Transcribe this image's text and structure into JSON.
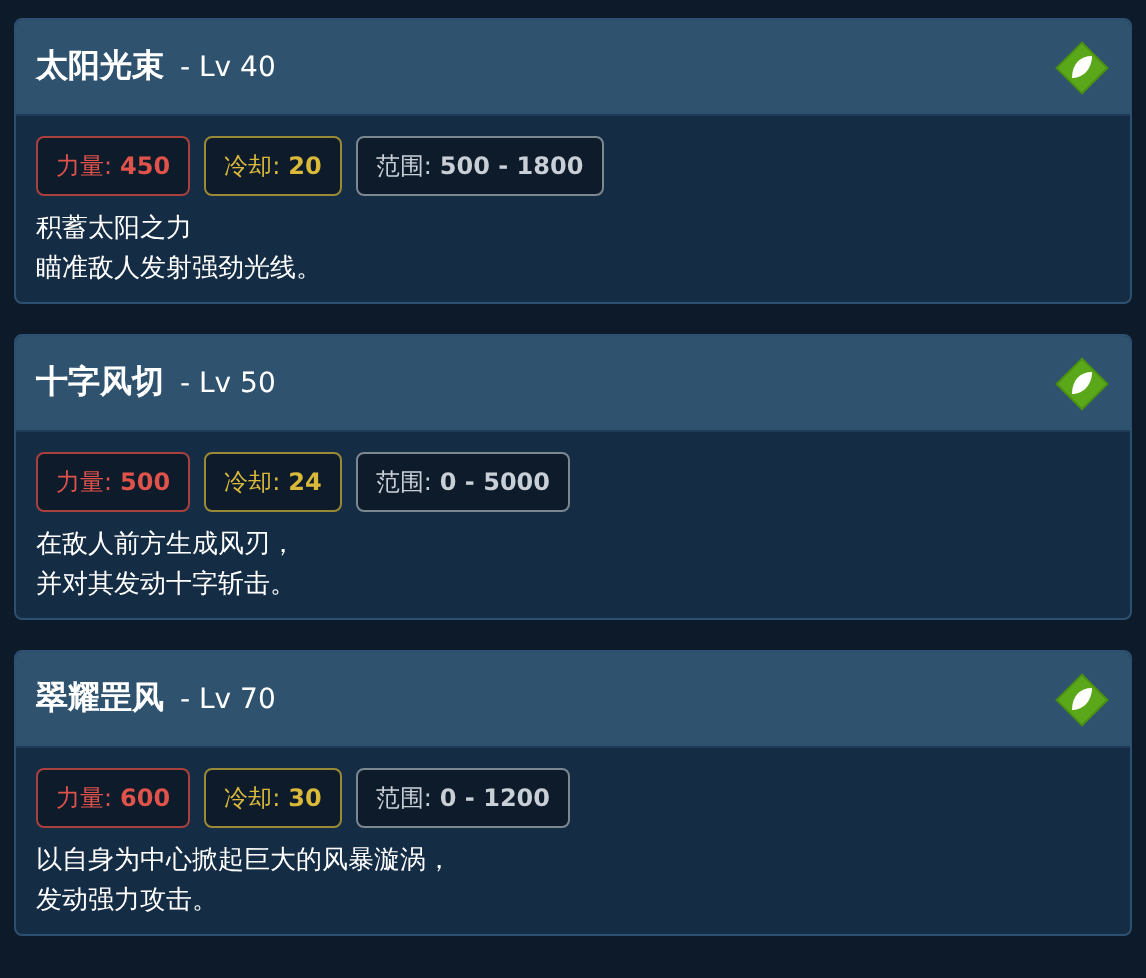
{
  "skills": [
    {
      "name": "太阳光束",
      "level": "- Lv 40",
      "stats": [
        {
          "kind": "power",
          "label": "力量:",
          "value": "450"
        },
        {
          "kind": "cooldown",
          "label": "冷却:",
          "value": "20"
        },
        {
          "kind": "range",
          "label": "范围:",
          "value": "500 - 1800"
        }
      ],
      "description": [
        "积蓄太阳之力",
        "瞄准敌人发射强劲光线。"
      ]
    },
    {
      "name": "十字风切",
      "level": "- Lv 50",
      "stats": [
        {
          "kind": "power",
          "label": "力量:",
          "value": "500"
        },
        {
          "kind": "cooldown",
          "label": "冷却:",
          "value": "24"
        },
        {
          "kind": "range",
          "label": "范围:",
          "value": "0 - 5000"
        }
      ],
      "description": [
        "在敌人前方生成风刃，",
        "并对其发动十字斩击。"
      ]
    },
    {
      "name": "翠耀罡风",
      "level": "- Lv 70",
      "stats": [
        {
          "kind": "power",
          "label": "力量:",
          "value": "600"
        },
        {
          "kind": "cooldown",
          "label": "冷却:",
          "value": "30"
        },
        {
          "kind": "range",
          "label": "范围:",
          "value": "0 - 1200"
        }
      ],
      "description": [
        "以自身为中心掀起巨大的风暴漩涡，",
        "发动强力攻击。"
      ]
    }
  ]
}
